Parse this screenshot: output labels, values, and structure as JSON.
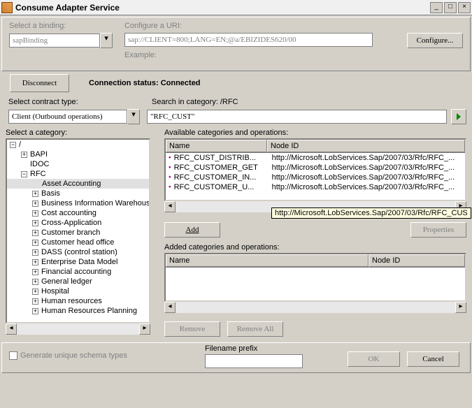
{
  "window": {
    "title": "Consume Adapter Service"
  },
  "bindingSection": {
    "labelBinding": "Select a binding:",
    "bindingValue": "sapBinding",
    "labelUri": "Configure a URI:",
    "uriValue": "sap://CLIENT=800;LANG=EN;@a/EBIZIDES620/00",
    "configureBtn": "Configure...",
    "exampleLabel": "Example:"
  },
  "connect": {
    "disconnectBtn": "Disconnect",
    "statusLabel": "Connection status:",
    "statusValue": "Connected"
  },
  "contract": {
    "label": "Select contract type:",
    "value": "Client (Outbound operations)",
    "searchLabel": "Search in category: /RFC",
    "searchValue": "\"RFC_CUST\""
  },
  "categoryLabel": "Select a category:",
  "tree": {
    "root": "/",
    "nodes": [
      "BAPI",
      "IDOC"
    ],
    "rfc": "RFC",
    "rfcChildren": [
      "Asset Accounting",
      "Basis",
      "Business Information Warehouse",
      "Cost accounting",
      "Cross-Application",
      "Customer branch",
      "Customer head office",
      "DASS (control station)",
      "Enterprise Data Model",
      "Financial accounting",
      "General ledger",
      "Hospital",
      "Human resources",
      "Human Resources Planning"
    ]
  },
  "available": {
    "label": "Available categories and operations:",
    "colName": "Name",
    "colNode": "Node ID",
    "rows": [
      {
        "name": "RFC_CUST_DISTRIB...",
        "node": "http://Microsoft.LobServices.Sap/2007/03/Rfc/RFC_..."
      },
      {
        "name": "RFC_CUSTOMER_GET",
        "node": "http://Microsoft.LobServices.Sap/2007/03/Rfc/RFC_..."
      },
      {
        "name": "RFC_CUSTOMER_IN...",
        "node": "http://Microsoft.LobServices.Sap/2007/03/Rfc/RFC_..."
      },
      {
        "name": "RFC_CUSTOMER_U...",
        "node": "http://Microsoft.LobServices.Sap/2007/03/Rfc/RFC_..."
      }
    ],
    "tooltip": "http://Microsoft.LobServices.Sap/2007/03/Rfc/RFC_CUS"
  },
  "addBtn": "Add",
  "propertiesBtn": "Properties",
  "added": {
    "label": "Added categories and operations:",
    "colName": "Name",
    "colNode": "Node ID"
  },
  "removeBtn": "Remove",
  "removeAllBtn": "Remove All",
  "footer": {
    "chkLabel": "Generate unique schema types",
    "filenameLabel": "Filename prefix",
    "okBtn": "OK",
    "cancelBtn": "Cancel"
  }
}
